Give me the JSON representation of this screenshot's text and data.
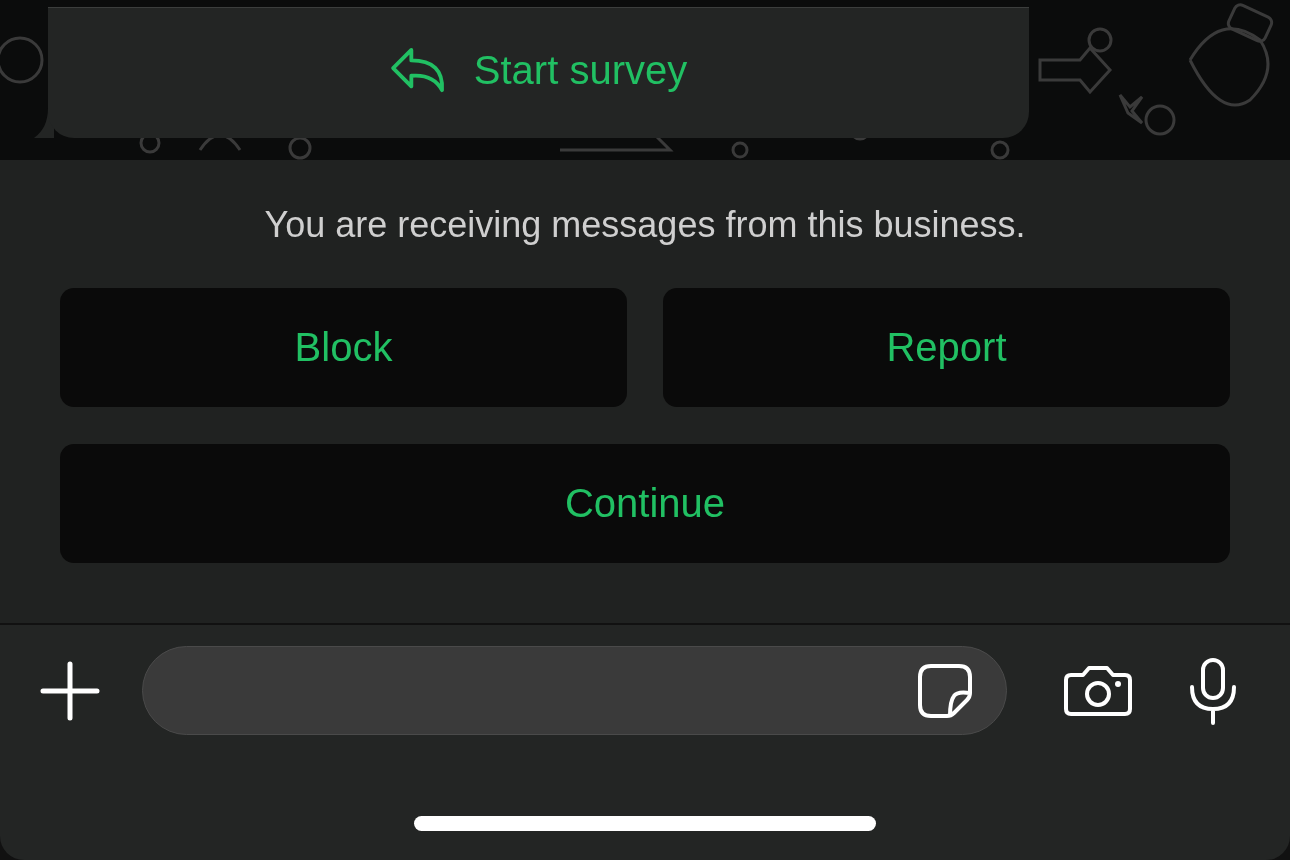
{
  "message": {
    "action_label": "Start survey"
  },
  "notice": {
    "text": "You are receiving messages from this business.",
    "buttons": [
      {
        "label": "Block"
      },
      {
        "label": "Report"
      },
      {
        "label": "Continue"
      }
    ]
  }
}
